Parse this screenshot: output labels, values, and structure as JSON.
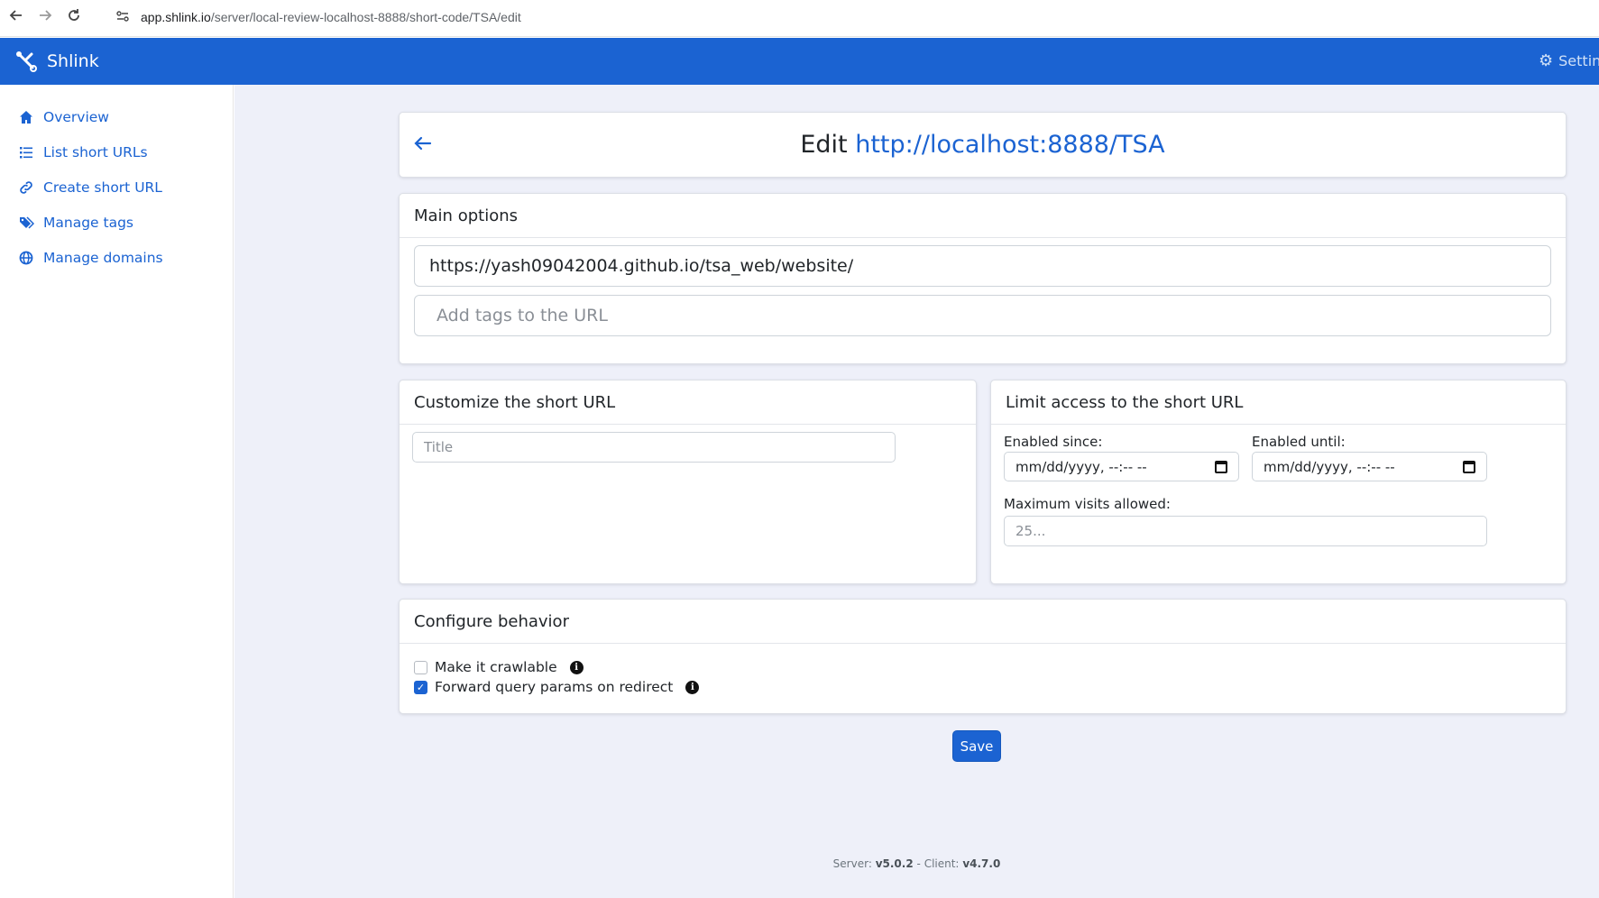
{
  "browser": {
    "url_host": "app.shlink.io",
    "url_path": "/server/local-review-localhost-8888/short-code/TSA/edit"
  },
  "header": {
    "brand": "Shlink",
    "settings_label": "Settin"
  },
  "sidebar": {
    "items": [
      {
        "label": "Overview",
        "icon": "home-icon"
      },
      {
        "label": "List short URLs",
        "icon": "list-icon"
      },
      {
        "label": "Create short URL",
        "icon": "link-icon"
      },
      {
        "label": "Manage tags",
        "icon": "tags-icon"
      },
      {
        "label": "Manage domains",
        "icon": "globe-icon"
      }
    ]
  },
  "edit": {
    "prefix": "Edit",
    "short_url": "http://localhost:8888/TSA"
  },
  "main_options": {
    "title": "Main options",
    "long_url_value": "https://yash09042004.github.io/tsa_web/website/",
    "tags_placeholder": "Add tags to the URL"
  },
  "customize": {
    "title": "Customize the short URL",
    "title_placeholder": "Title"
  },
  "limit": {
    "title": "Limit access to the short URL",
    "enabled_since_label": "Enabled since:",
    "enabled_since_value": "mm/dd/yyyy, --:-- --",
    "enabled_until_label": "Enabled until:",
    "enabled_until_value": "mm/dd/yyyy, --:-- --",
    "max_visits_label": "Maximum visits allowed:",
    "max_visits_placeholder": "25..."
  },
  "behavior": {
    "title": "Configure behavior",
    "options": [
      {
        "label": "Make it crawlable",
        "checked": false
      },
      {
        "label": "Forward query params on redirect",
        "checked": true
      }
    ]
  },
  "save_label": "Save",
  "footer": {
    "server_label": "Server:",
    "server_version": "v5.0.2",
    "separator": "-",
    "client_label": "Client:",
    "client_version": "v4.7.0"
  },
  "colors": {
    "primary": "#1b63d2",
    "background": "#eef0f9"
  }
}
